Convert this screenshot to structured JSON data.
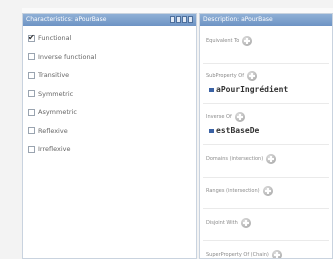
{
  "left_panel": {
    "title": "Characteristics: aPourBase",
    "characteristics": [
      {
        "label": "Functional",
        "checked": true
      },
      {
        "label": "Inverse functional",
        "checked": false
      },
      {
        "label": "Transitive",
        "checked": false
      },
      {
        "label": "Symmetric",
        "checked": false
      },
      {
        "label": "Asymmetric",
        "checked": false
      },
      {
        "label": "Reflexive",
        "checked": false
      },
      {
        "label": "Irreflexive",
        "checked": false
      }
    ]
  },
  "right_panel": {
    "title": "Description: aPourBase",
    "sections": [
      {
        "label": "Equivalent To",
        "value": ""
      },
      {
        "label": "SubProperty Of",
        "value": "aPourIngrédient"
      },
      {
        "label": "Inverse Of",
        "value": "estBaseDe"
      },
      {
        "label": "Domains (intersection)",
        "value": ""
      },
      {
        "label": "Ranges (intersection)",
        "value": ""
      },
      {
        "label": "Disjoint With",
        "value": ""
      },
      {
        "label": "SuperProperty Of (Chain)",
        "value": ""
      }
    ]
  },
  "colors": {
    "header_bg": "#7a9ecb",
    "entity_marker": "#3b62a4"
  },
  "icons": {
    "add": "add-circle-icon",
    "entity": "object-property-icon",
    "check": "checkmark-icon"
  }
}
